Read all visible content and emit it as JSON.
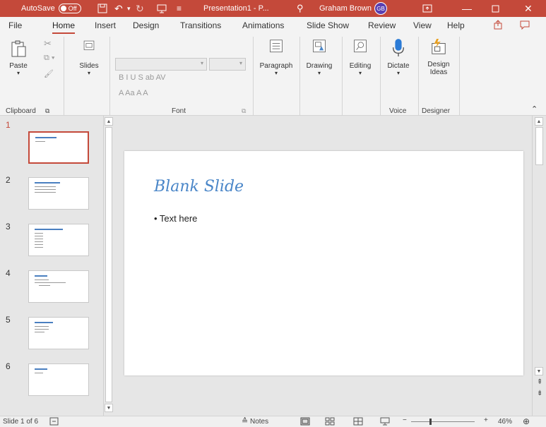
{
  "titlebar": {
    "autosave_label": "AutoSave",
    "autosave_state": "Off",
    "doc_title": "Presentation1 - P...",
    "user_name": "Graham Brown",
    "user_initials": "GB",
    "bg_color": "#c4493a"
  },
  "tabs": [
    "File",
    "Home",
    "Insert",
    "Design",
    "Transitions",
    "Animations",
    "Slide Show",
    "Review",
    "View",
    "Help"
  ],
  "active_tab": "Home",
  "ribbon": {
    "paste_label": "Paste",
    "slides_label": "Slides",
    "clipboard_group": "Clipboard",
    "font_group": "Font",
    "paragraph_label": "Paragraph",
    "drawing_label": "Drawing",
    "editing_label": "Editing",
    "dictate_label": "Dictate",
    "voice_group": "Voice",
    "design_ideas_line1": "Design",
    "design_ideas_line2": "Ideas",
    "designer_group": "Designer",
    "font_format_row": "B  I  U  S  ab  AV",
    "font_color_row": "A  Aa  A  A"
  },
  "thumbnails": [
    {
      "num": "1",
      "selected": true
    },
    {
      "num": "2",
      "selected": false
    },
    {
      "num": "3",
      "selected": false
    },
    {
      "num": "4",
      "selected": false
    },
    {
      "num": "5",
      "selected": false
    },
    {
      "num": "6",
      "selected": false
    }
  ],
  "slide": {
    "title": "Blank Slide",
    "bullet": "• Text here",
    "title_color": "#4a86c8"
  },
  "statusbar": {
    "slide_info": "Slide 1 of 6",
    "notes_label": "Notes",
    "zoom": "46%"
  }
}
